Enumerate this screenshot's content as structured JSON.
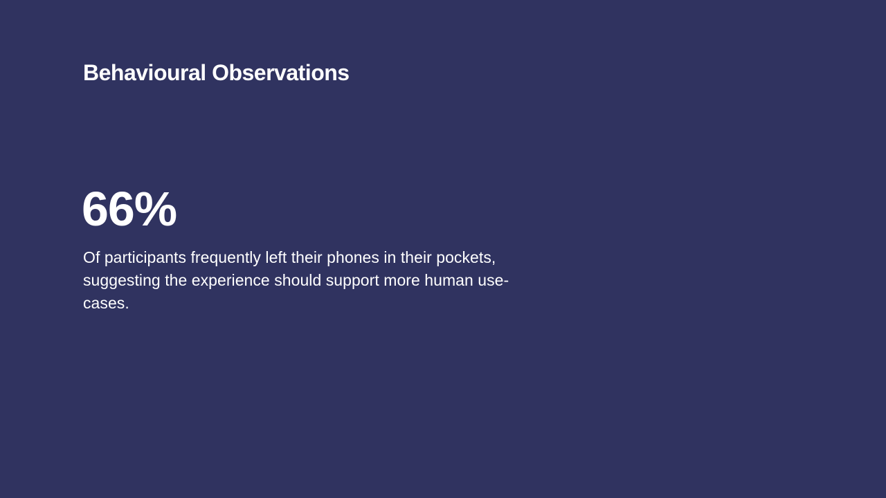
{
  "slide": {
    "title": "Behavioural Observations",
    "stat": "66%",
    "description": "Of participants frequently left their phones in their pockets, suggesting the experience should support more human use-cases.",
    "colors": {
      "background": "#303360",
      "text": "#ffffff"
    }
  }
}
